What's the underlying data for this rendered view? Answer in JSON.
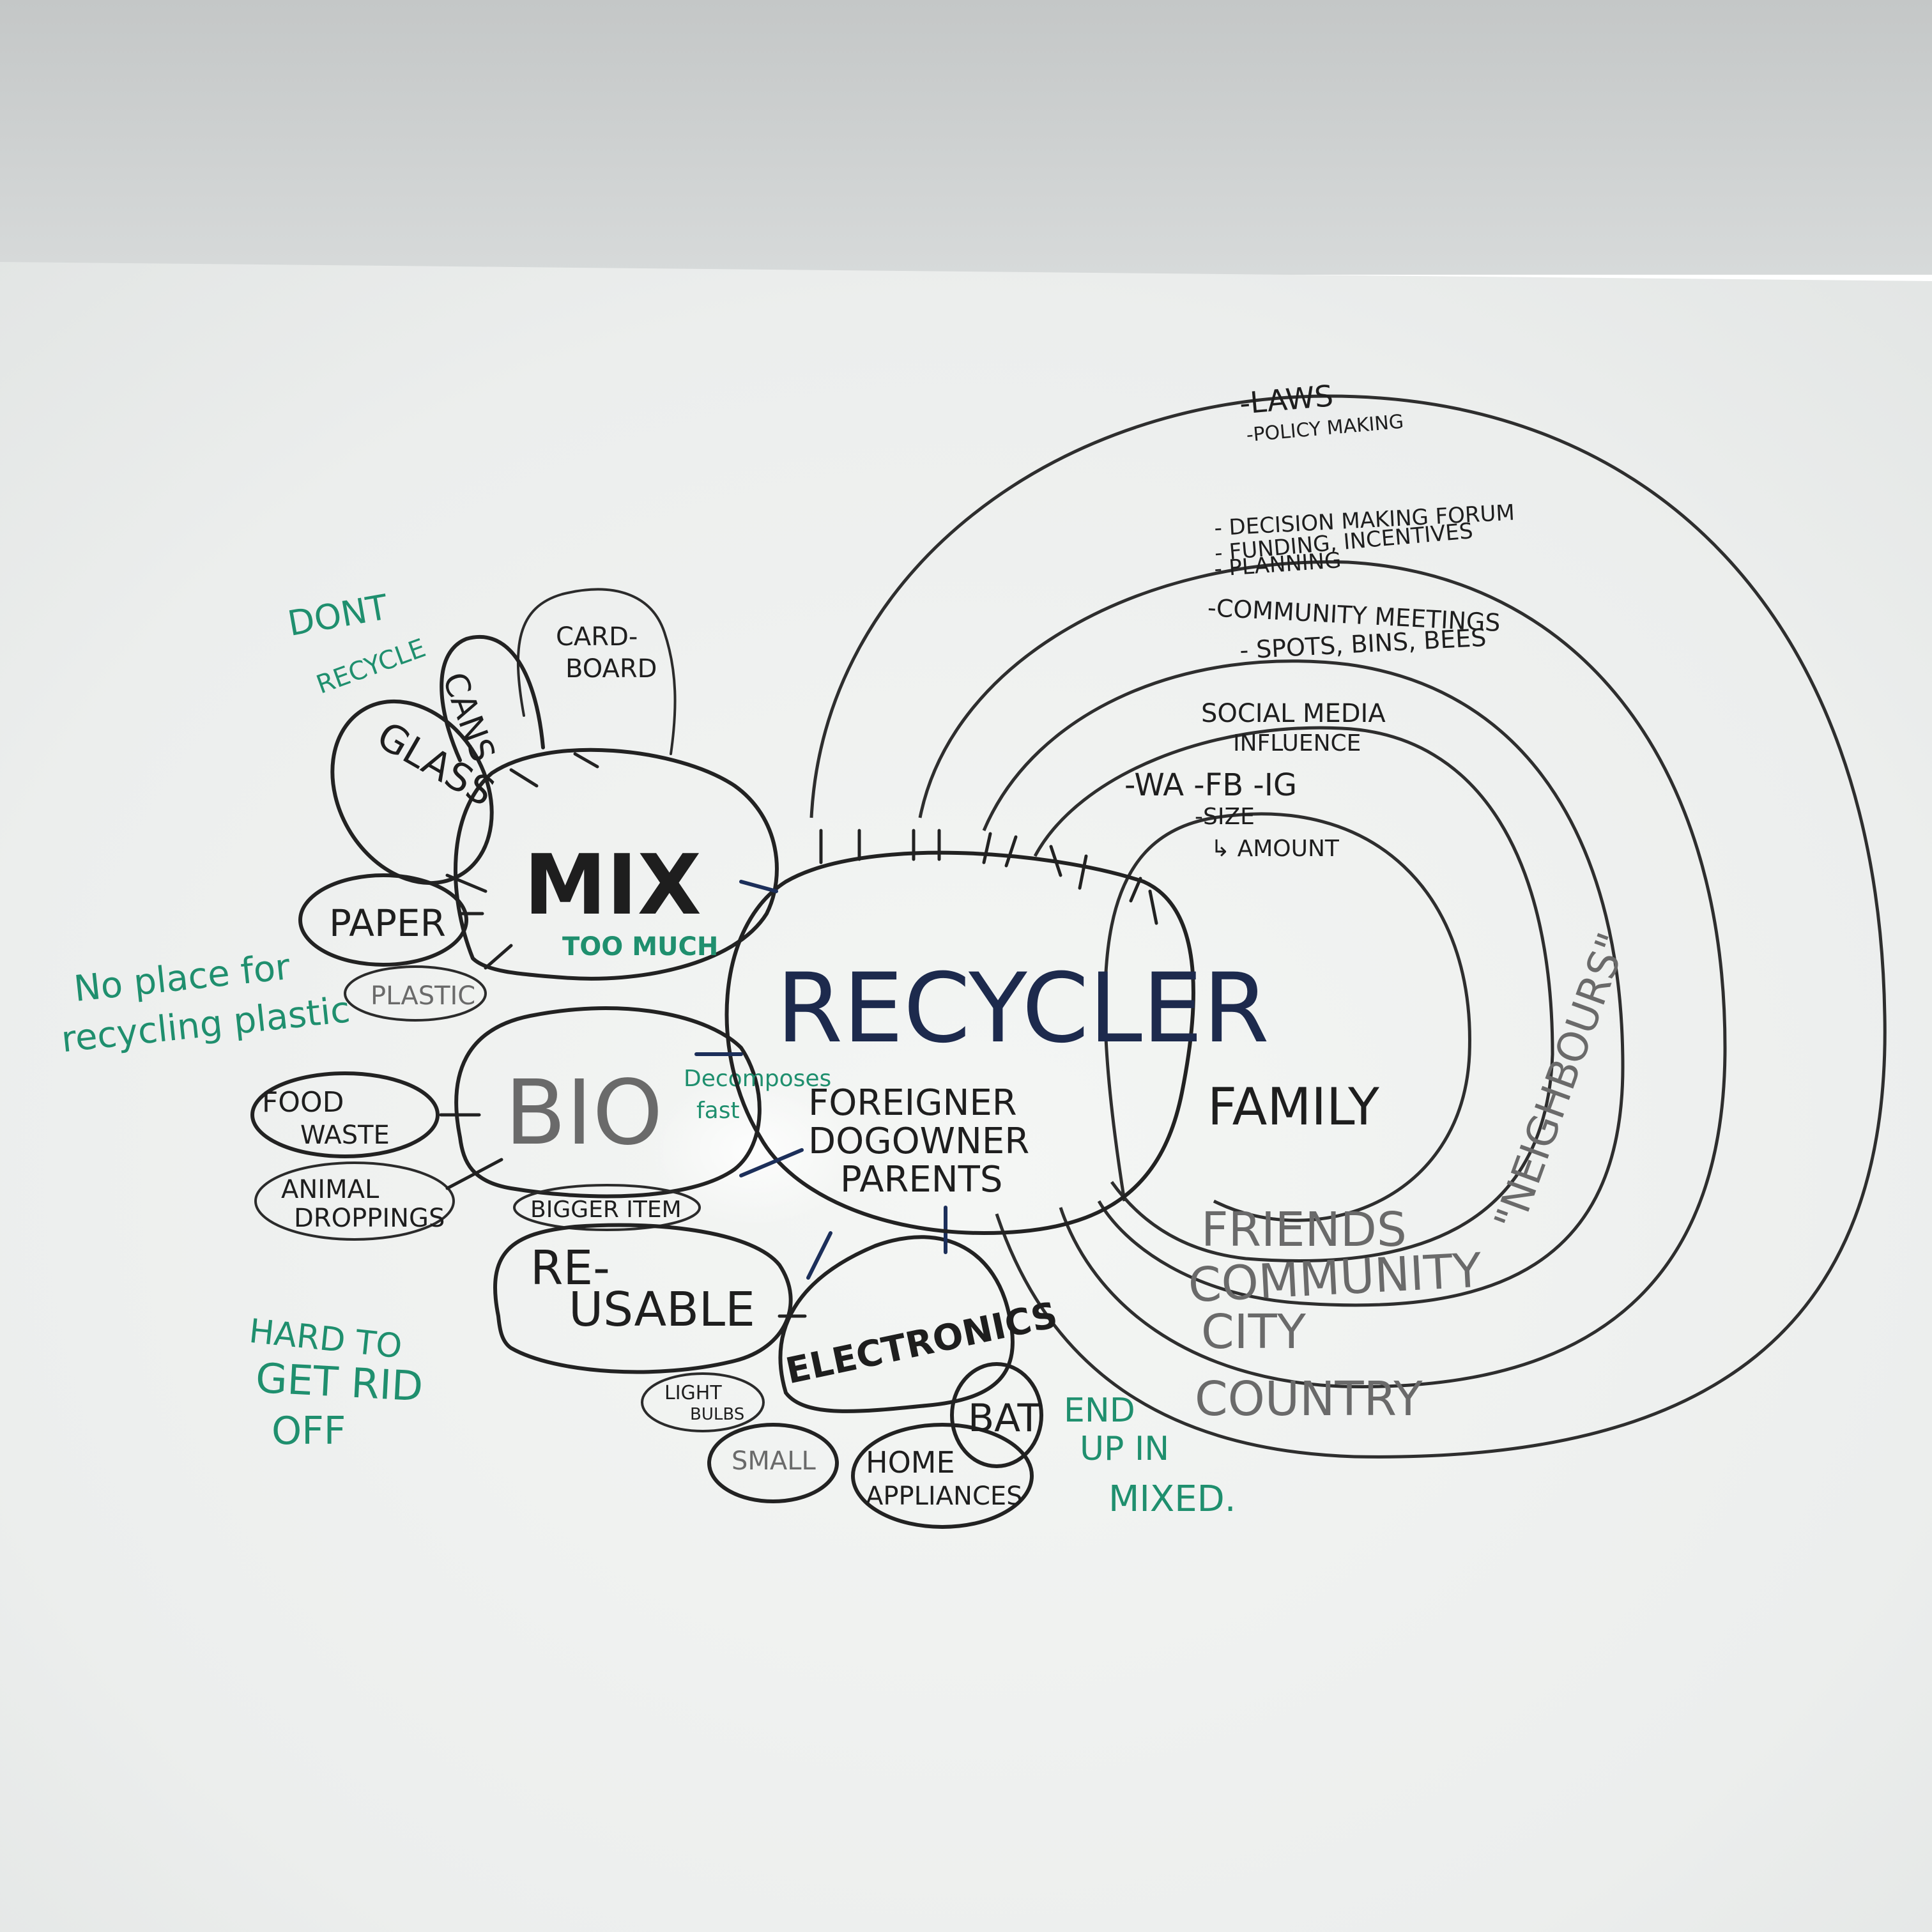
{
  "colors": {
    "wall_top": "#c9cccc",
    "board": "#eef0ee",
    "ink_black": "#1e1e1e",
    "ink_navy": "#1d2a4d",
    "ink_green": "#1f8f6e",
    "ink_gray": "#6a6a6a"
  },
  "center": {
    "title": "RECYCLER",
    "line1": "FOREIGNER",
    "line2": "DOGOWNER",
    "line3": "PARENTS"
  },
  "mix": {
    "title": "MIX",
    "note": "TOO MUCH",
    "items": {
      "cans": "CANS",
      "cardboard_1": "CARD-",
      "cardboard_2": "BOARD",
      "glass": "GLASS",
      "paper": "PAPER",
      "plastic": "PLASTIC"
    }
  },
  "bio": {
    "title": "BIO",
    "note_1": "Decomposes",
    "note_2": "fast",
    "items": {
      "food_1": "FOOD",
      "food_2": "WASTE",
      "animal_1": "ANIMAL",
      "animal_2": "DROPPINGS"
    }
  },
  "reusable": {
    "title_1": "RE-",
    "title_2": "USABLE",
    "bigger": "BIGGER ITEM"
  },
  "electronics": {
    "title": "ELECTRONICS",
    "items": {
      "light_1": "LIGHT",
      "light_2": "BULBS",
      "small": "SMALL",
      "home_1": "HOME",
      "home_2": "APPLIANCES",
      "bat": "BAT"
    }
  },
  "rings": {
    "family": "FAMILY",
    "friends": "FRIENDS",
    "community": "COMMUNITY",
    "city": "CITY",
    "country": "COUNTRY",
    "neighbours": "\"NEIGHBOURS\""
  },
  "ring_notes": {
    "size": "-SIZE",
    "amount": "↳ AMOUNT",
    "social_1": "SOCIAL MEDIA",
    "social_2": "INFLUENCE",
    "social_3": "-WA  -FB  -IG",
    "meetings_1": "-COMMUNITY MEETINGS",
    "meetings_2": "- SPOTS, BINS, BEES",
    "decision_1": "- DECISION MAKING FORUM",
    "decision_2": "- FUNDING, INCENTIVES",
    "decision_3": "- PLANNING",
    "laws_1": "-LAWS",
    "laws_2": "-POLICY MAKING"
  },
  "green_notes": {
    "dont_1": "DONT",
    "dont_2": "RECYCLE",
    "noplace_1": "No place for",
    "noplace_2": "recycling plastic",
    "hard_1": "HARD TO",
    "hard_2": "GET RID",
    "hard_3": "OFF",
    "endup_1": "END",
    "endup_2": "UP IN",
    "endup_3": "MIXED."
  }
}
